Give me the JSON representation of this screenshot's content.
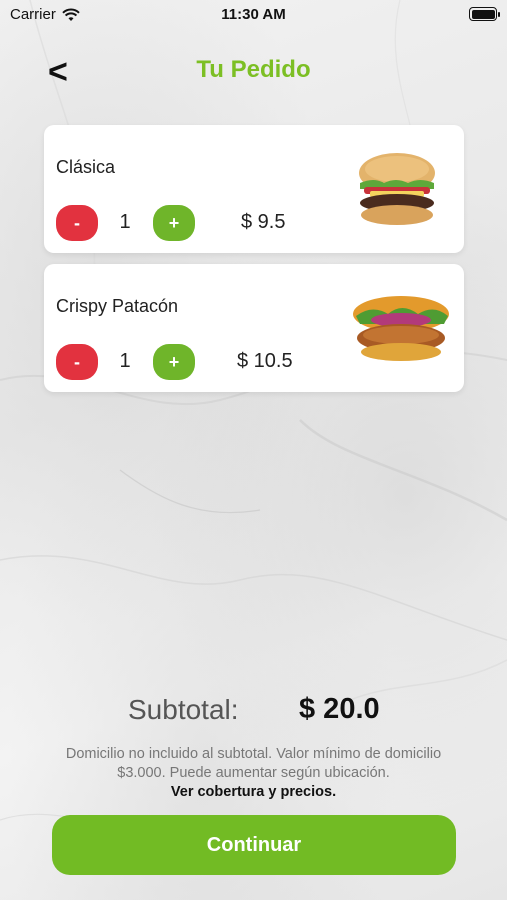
{
  "status_bar": {
    "carrier": "Carrier",
    "time": "11:30 AM"
  },
  "header": {
    "back": "<",
    "title": "Tu Pedido"
  },
  "items": [
    {
      "name": "Clásica",
      "minus": "-",
      "quantity": "1",
      "plus": "+",
      "price": "$ 9.5",
      "image": "burger-classic-image"
    },
    {
      "name": "Crispy Patacón",
      "minus": "-",
      "quantity": "1",
      "plus": "+",
      "price": "$ 10.5",
      "image": "burger-crispy-patacon-image"
    }
  ],
  "summary": {
    "subtotal_label": "Subtotal:",
    "subtotal_value": "$ 20.0",
    "note": "Domicilio no incluido al subtotal. Valor mínimo de domicilio $3.000. Puede aumentar según ubicación.",
    "coverage_link": "Ver cobertura y precios."
  },
  "continue_button": "Continuar",
  "colors": {
    "accent_green": "#7cbf24",
    "minus_red": "#e2323f",
    "plus_green": "#6fb52a"
  }
}
